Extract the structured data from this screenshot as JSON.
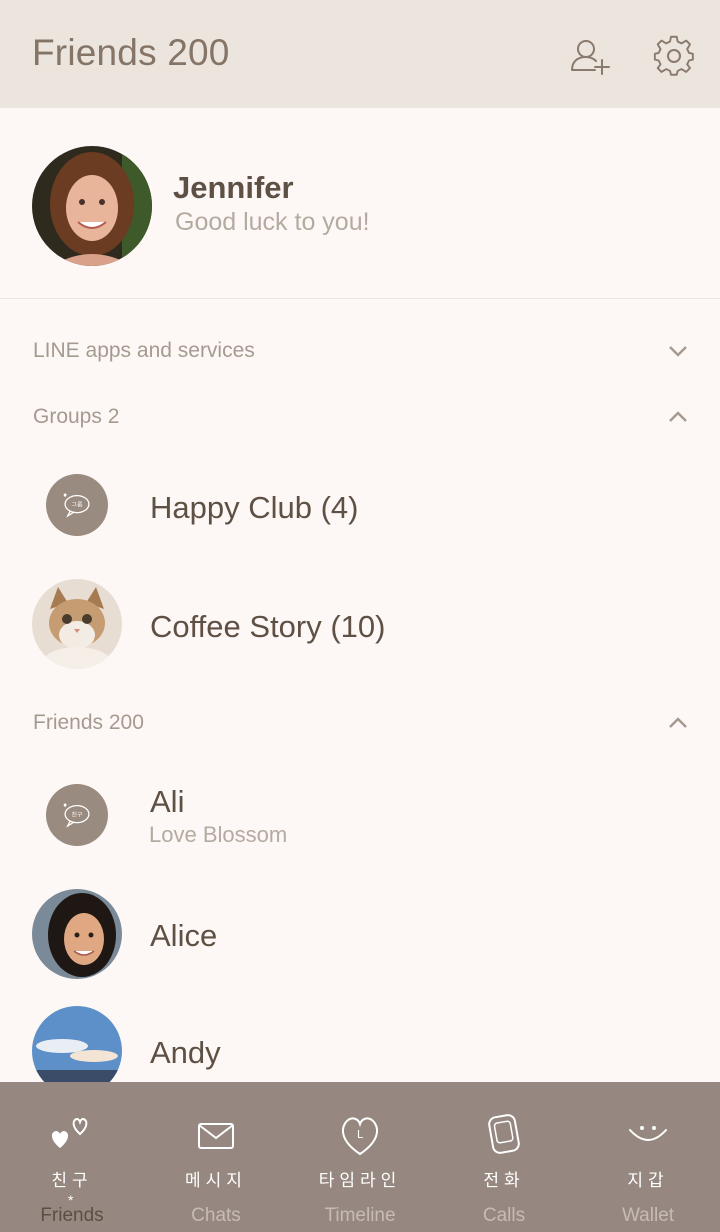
{
  "header": {
    "title": "Friends 200"
  },
  "profile": {
    "name": "Jennifer",
    "status": "Good luck to you!"
  },
  "sections": {
    "services": "LINE apps and services",
    "groups": "Groups 2",
    "friends": "Friends 200"
  },
  "groups": [
    {
      "name": "Happy Club (4)"
    },
    {
      "name": "Coffee Story (10)"
    }
  ],
  "friends": [
    {
      "name": "Ali",
      "status": "Love Blossom"
    },
    {
      "name": "Alice"
    },
    {
      "name": "Andy"
    }
  ],
  "placeholder_avatar_text": {
    "group": "그룹",
    "friend": "친구"
  },
  "tabs": [
    {
      "ko": "친구",
      "label": "Friends",
      "icon": "hearts-icon",
      "active": true
    },
    {
      "ko": "메시지",
      "label": "Chats",
      "icon": "envelope-icon"
    },
    {
      "ko": "타임라인",
      "label": "Timeline",
      "icon": "heart-l-icon"
    },
    {
      "ko": "전화",
      "label": "Calls",
      "icon": "phone-icon"
    },
    {
      "ko": "지갑",
      "label": "Wallet",
      "icon": "smile-icon"
    }
  ],
  "colors": {
    "header_bg": "#ece5de",
    "page_bg": "#fdf8f5",
    "tabbar_bg": "#968880",
    "text_primary": "#5f5045",
    "text_muted": "#b5aaa0"
  }
}
